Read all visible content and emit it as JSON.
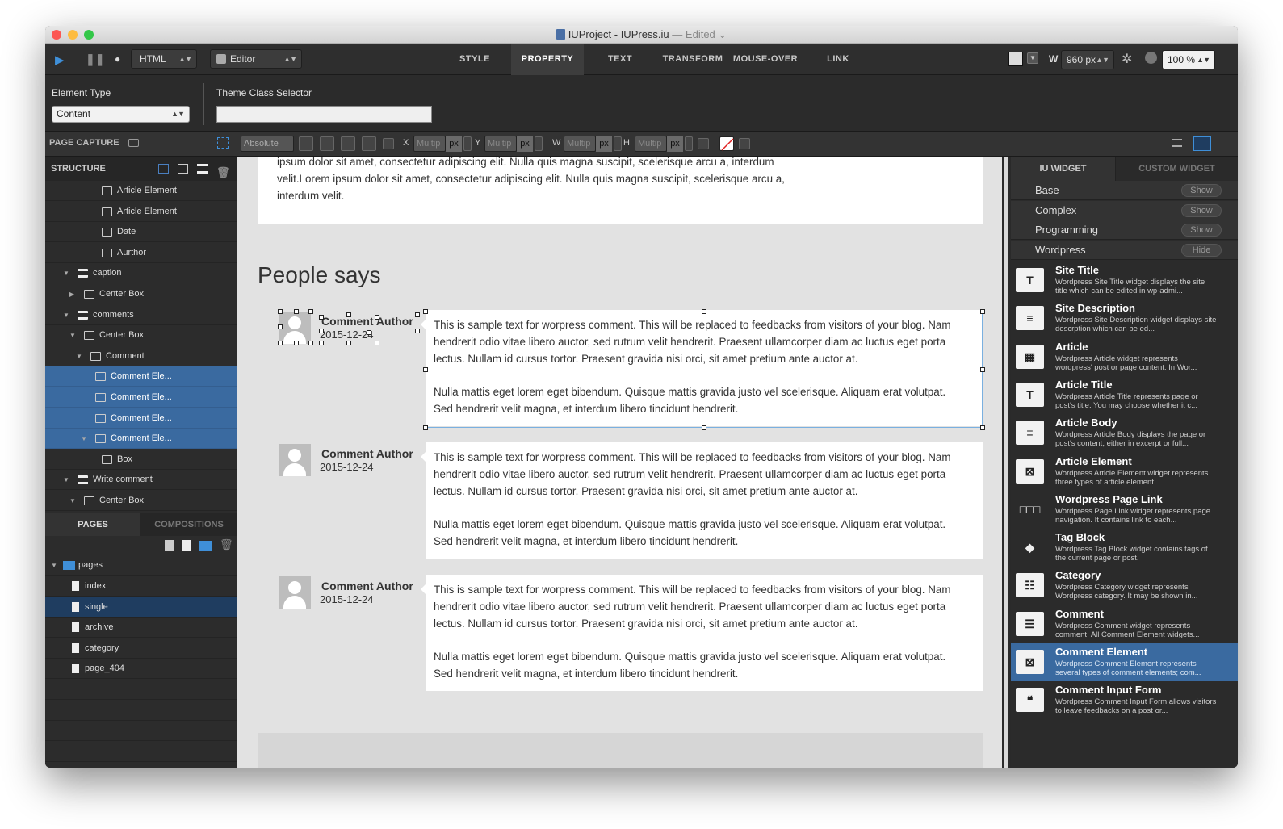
{
  "window": {
    "title": "IUProject - IUPress.iu",
    "edited": "Edited",
    "colors": {
      "close": "#fc5753",
      "minimize": "#fdbc40",
      "zoom": "#33c748",
      "selection": "#3a6aa0",
      "accent_blue": "#3f8fd8"
    }
  },
  "toolbar": {
    "language": "HTML",
    "mode": "Editor",
    "tabs": [
      "STYLE",
      "PROPERTY",
      "TEXT",
      "TRANSFORM",
      "MOUSE-OVER",
      "LINK"
    ],
    "active_tab": "PROPERTY",
    "width_label": "W",
    "width_value": "960 px",
    "zoom": "100 %"
  },
  "properties": {
    "element_type_label": "Element Type",
    "element_type_value": "Content",
    "theme_class_label": "Theme Class Selector",
    "theme_class_value": ""
  },
  "layoutbar": {
    "page_capture": "PAGE CAPTURE",
    "position_mode": "Absolute",
    "x_label": "X",
    "y_label": "Y",
    "w_label": "W",
    "h_label": "H",
    "placeholder": "Multip",
    "unit": "px"
  },
  "structure": {
    "header": "STRUCTURE",
    "items": [
      {
        "label": "Article Element",
        "icon": "article-element-icon"
      },
      {
        "label": "Article Element",
        "icon": "article-element-icon"
      },
      {
        "label": "Date",
        "icon": "text-icon"
      },
      {
        "label": "Aurthor",
        "icon": "text-icon"
      },
      {
        "label": "caption",
        "icon": "box-icon"
      },
      {
        "label": "Center Box",
        "icon": "center-box-icon"
      },
      {
        "label": "comments",
        "icon": "box-icon"
      },
      {
        "label": "Center Box",
        "icon": "center-box-icon"
      },
      {
        "label": "Comment",
        "icon": "comment-icon"
      },
      {
        "label": "Comment Ele...",
        "icon": "comment-element-icon"
      },
      {
        "label": "Comment Ele...",
        "icon": "comment-element-icon"
      },
      {
        "label": "Comment Ele...",
        "icon": "comment-element-icon"
      },
      {
        "label": "Comment Ele...",
        "icon": "comment-element-icon"
      },
      {
        "label": "Box",
        "icon": "box-outline-icon"
      },
      {
        "label": "Write comment",
        "icon": "box-icon"
      },
      {
        "label": "Center Box",
        "icon": "center-box-icon"
      }
    ]
  },
  "pages": {
    "tabs": [
      "PAGES",
      "COMPOSITIONS"
    ],
    "root": "pages",
    "items": [
      "index",
      "single",
      "archive",
      "category",
      "page_404"
    ],
    "selected": "single"
  },
  "canvas": {
    "intro_lines": [
      "ipsum dolor sit amet, consectetur adipiscing elit. Nulla quis magna suscipit, scelerisque arcu a, interdum",
      "velit.Lorem ipsum dolor sit amet, consectetur adipiscing elit. Nulla quis magna suscipit, scelerisque arcu a,",
      "interdum velit."
    ],
    "heading": "People says",
    "comments": [
      {
        "author": "Comment Author",
        "date": "2015-12-24",
        "para1": [
          "This is sample text for worpress comment. This will be replaced to feedbacks from visitors of your blog. Nam",
          "hendrerit odio vitae libero auctor, sed rutrum velit hendrerit. Praesent ullamcorper diam ac luctus eget porta",
          "lectus. Nullam id cursus tortor. Praesent gravida nisi orci, sit amet pretium ante auctor at."
        ],
        "para2": [
          "Nulla mattis eget lorem eget bibendum. Quisque mattis gravida justo vel scelerisque. Aliquam erat volutpat.",
          "Sed hendrerit velit magna, et interdum libero tincidunt hendrerit."
        ]
      },
      {
        "author": "Comment Author",
        "date": "2015-12-24",
        "para1": [
          "This is sample text for worpress comment. This will be replaced to feedbacks from visitors of your blog. Nam",
          "hendrerit odio vitae libero auctor, sed rutrum velit hendrerit. Praesent ullamcorper diam ac luctus eget porta",
          "lectus. Nullam id cursus tortor. Praesent gravida nisi orci, sit amet pretium ante auctor at."
        ],
        "para2": [
          "Nulla mattis eget lorem eget bibendum. Quisque mattis gravida justo vel scelerisque. Aliquam erat volutpat.",
          "Sed hendrerit velit magna, et interdum libero tincidunt hendrerit."
        ]
      },
      {
        "author": "Comment Author",
        "date": "2015-12-24",
        "para1": [
          "This is sample text for worpress comment. This will be replaced to feedbacks from visitors of your blog. Nam",
          "hendrerit odio vitae libero auctor, sed rutrum velit hendrerit. Praesent ullamcorper diam ac luctus eget porta",
          "lectus. Nullam id cursus tortor. Praesent gravida nisi orci, sit amet pretium ante auctor at."
        ],
        "para2": [
          "Nulla mattis eget lorem eget bibendum. Quisque mattis gravida justo vel scelerisque. Aliquam erat volutpat.",
          "Sed hendrerit velit magna, et interdum libero tincidunt hendrerit."
        ]
      }
    ]
  },
  "widgets": {
    "tabs": [
      "IU WIDGET",
      "CUSTOM WIDGET"
    ],
    "categories": [
      {
        "label": "Base",
        "button": "Show"
      },
      {
        "label": "Complex",
        "button": "Show"
      },
      {
        "label": "Programming",
        "button": "Show"
      },
      {
        "label": "Wordpress",
        "button": "Hide"
      }
    ],
    "items": [
      {
        "title": "Site Title",
        "desc": "Wordpress Site Title widget displays the site title which can be edited in wp-admi...",
        "icon": "site-title-icon"
      },
      {
        "title": "Site Description",
        "desc": "Wordpress Site Description widget displays site descrption which can be ed...",
        "icon": "site-description-icon"
      },
      {
        "title": "Article",
        "desc": "Wordpress Article widget represents wordpress' post or page content. In Wor...",
        "icon": "article-icon"
      },
      {
        "title": "Article Title",
        "desc": "Wordpress Article Title represents page or post's title. You may choose whether it c...",
        "icon": "article-title-icon"
      },
      {
        "title": "Article Body",
        "desc": "Wordpress Article Body displays the page or post's content, either in excerpt or full...",
        "icon": "article-body-icon"
      },
      {
        "title": "Article Element",
        "desc": "Wordpress Article Element widget represents three types of article element...",
        "icon": "article-element-icon"
      },
      {
        "title": "Wordpress Page Link",
        "desc": "Wordpress Page Link widget represents page navigation. It contains link to each...",
        "icon": "page-link-icon"
      },
      {
        "title": "Tag Block",
        "desc": "Wordpress Tag Block widget contains tags of the current page or post.",
        "icon": "tag-icon"
      },
      {
        "title": "Category",
        "desc": "Wordpress Category widget represents Wordpress category. It may be shown in...",
        "icon": "category-icon"
      },
      {
        "title": "Comment",
        "desc": "Wordpress Comment widget represents comment. All Comment Element widgets...",
        "icon": "comment-icon"
      },
      {
        "title": "Comment Element",
        "desc": "Wordpress Comment Element represents several types of comment elements; com...",
        "icon": "comment-element-icon"
      },
      {
        "title": "Comment Input Form",
        "desc": "Wordpress Comment Input Form allows visitors to leave feedbacks on a post or...",
        "icon": "comment-input-icon"
      }
    ],
    "selected": "Comment Element"
  }
}
